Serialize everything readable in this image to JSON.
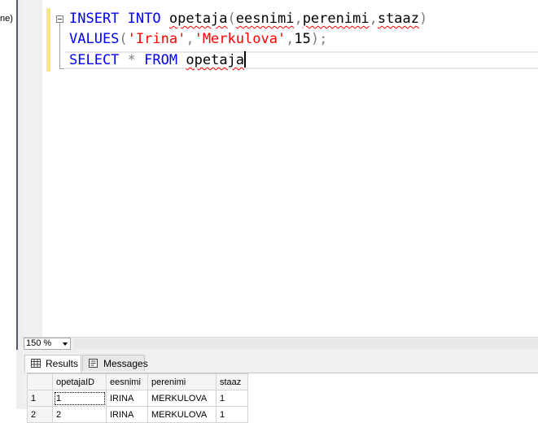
{
  "explorer": {
    "text": "ne)"
  },
  "editor": {
    "line1": {
      "kw1": "INSERT",
      "kw2": "INTO",
      "table": "opetaja",
      "open": "(",
      "col1": "eesnimi",
      "comma1": ",",
      "col2": "perenimi",
      "comma2": ",",
      "col3": "staaz",
      "close": ")"
    },
    "line2": {
      "kw": "VALUES",
      "open": "(",
      "v1": "'Irina'",
      "comma1": ",",
      "v2": "'Merkulova'",
      "comma2": ",",
      "v3": "15",
      "close": ")",
      "semi": ";"
    },
    "line3": {
      "kw1": "SELECT",
      "star": "*",
      "kw2": "FROM",
      "table": "opetaja"
    }
  },
  "zoom": {
    "value": "150 %"
  },
  "tabs": {
    "results": "Results",
    "messages": "Messages"
  },
  "grid": {
    "columns": [
      "opetajaID",
      "eesnimi",
      "perenimi",
      "staaz"
    ],
    "rows": [
      {
        "num": "1",
        "cells": [
          "1",
          "IRINA",
          "MERKULOVA",
          "1"
        ]
      },
      {
        "num": "2",
        "cells": [
          "2",
          "IRINA",
          "MERKULOVA",
          "1"
        ]
      }
    ]
  },
  "colors": {
    "keyword": "#0000ff",
    "string": "#ff0000",
    "operator": "#808080"
  }
}
